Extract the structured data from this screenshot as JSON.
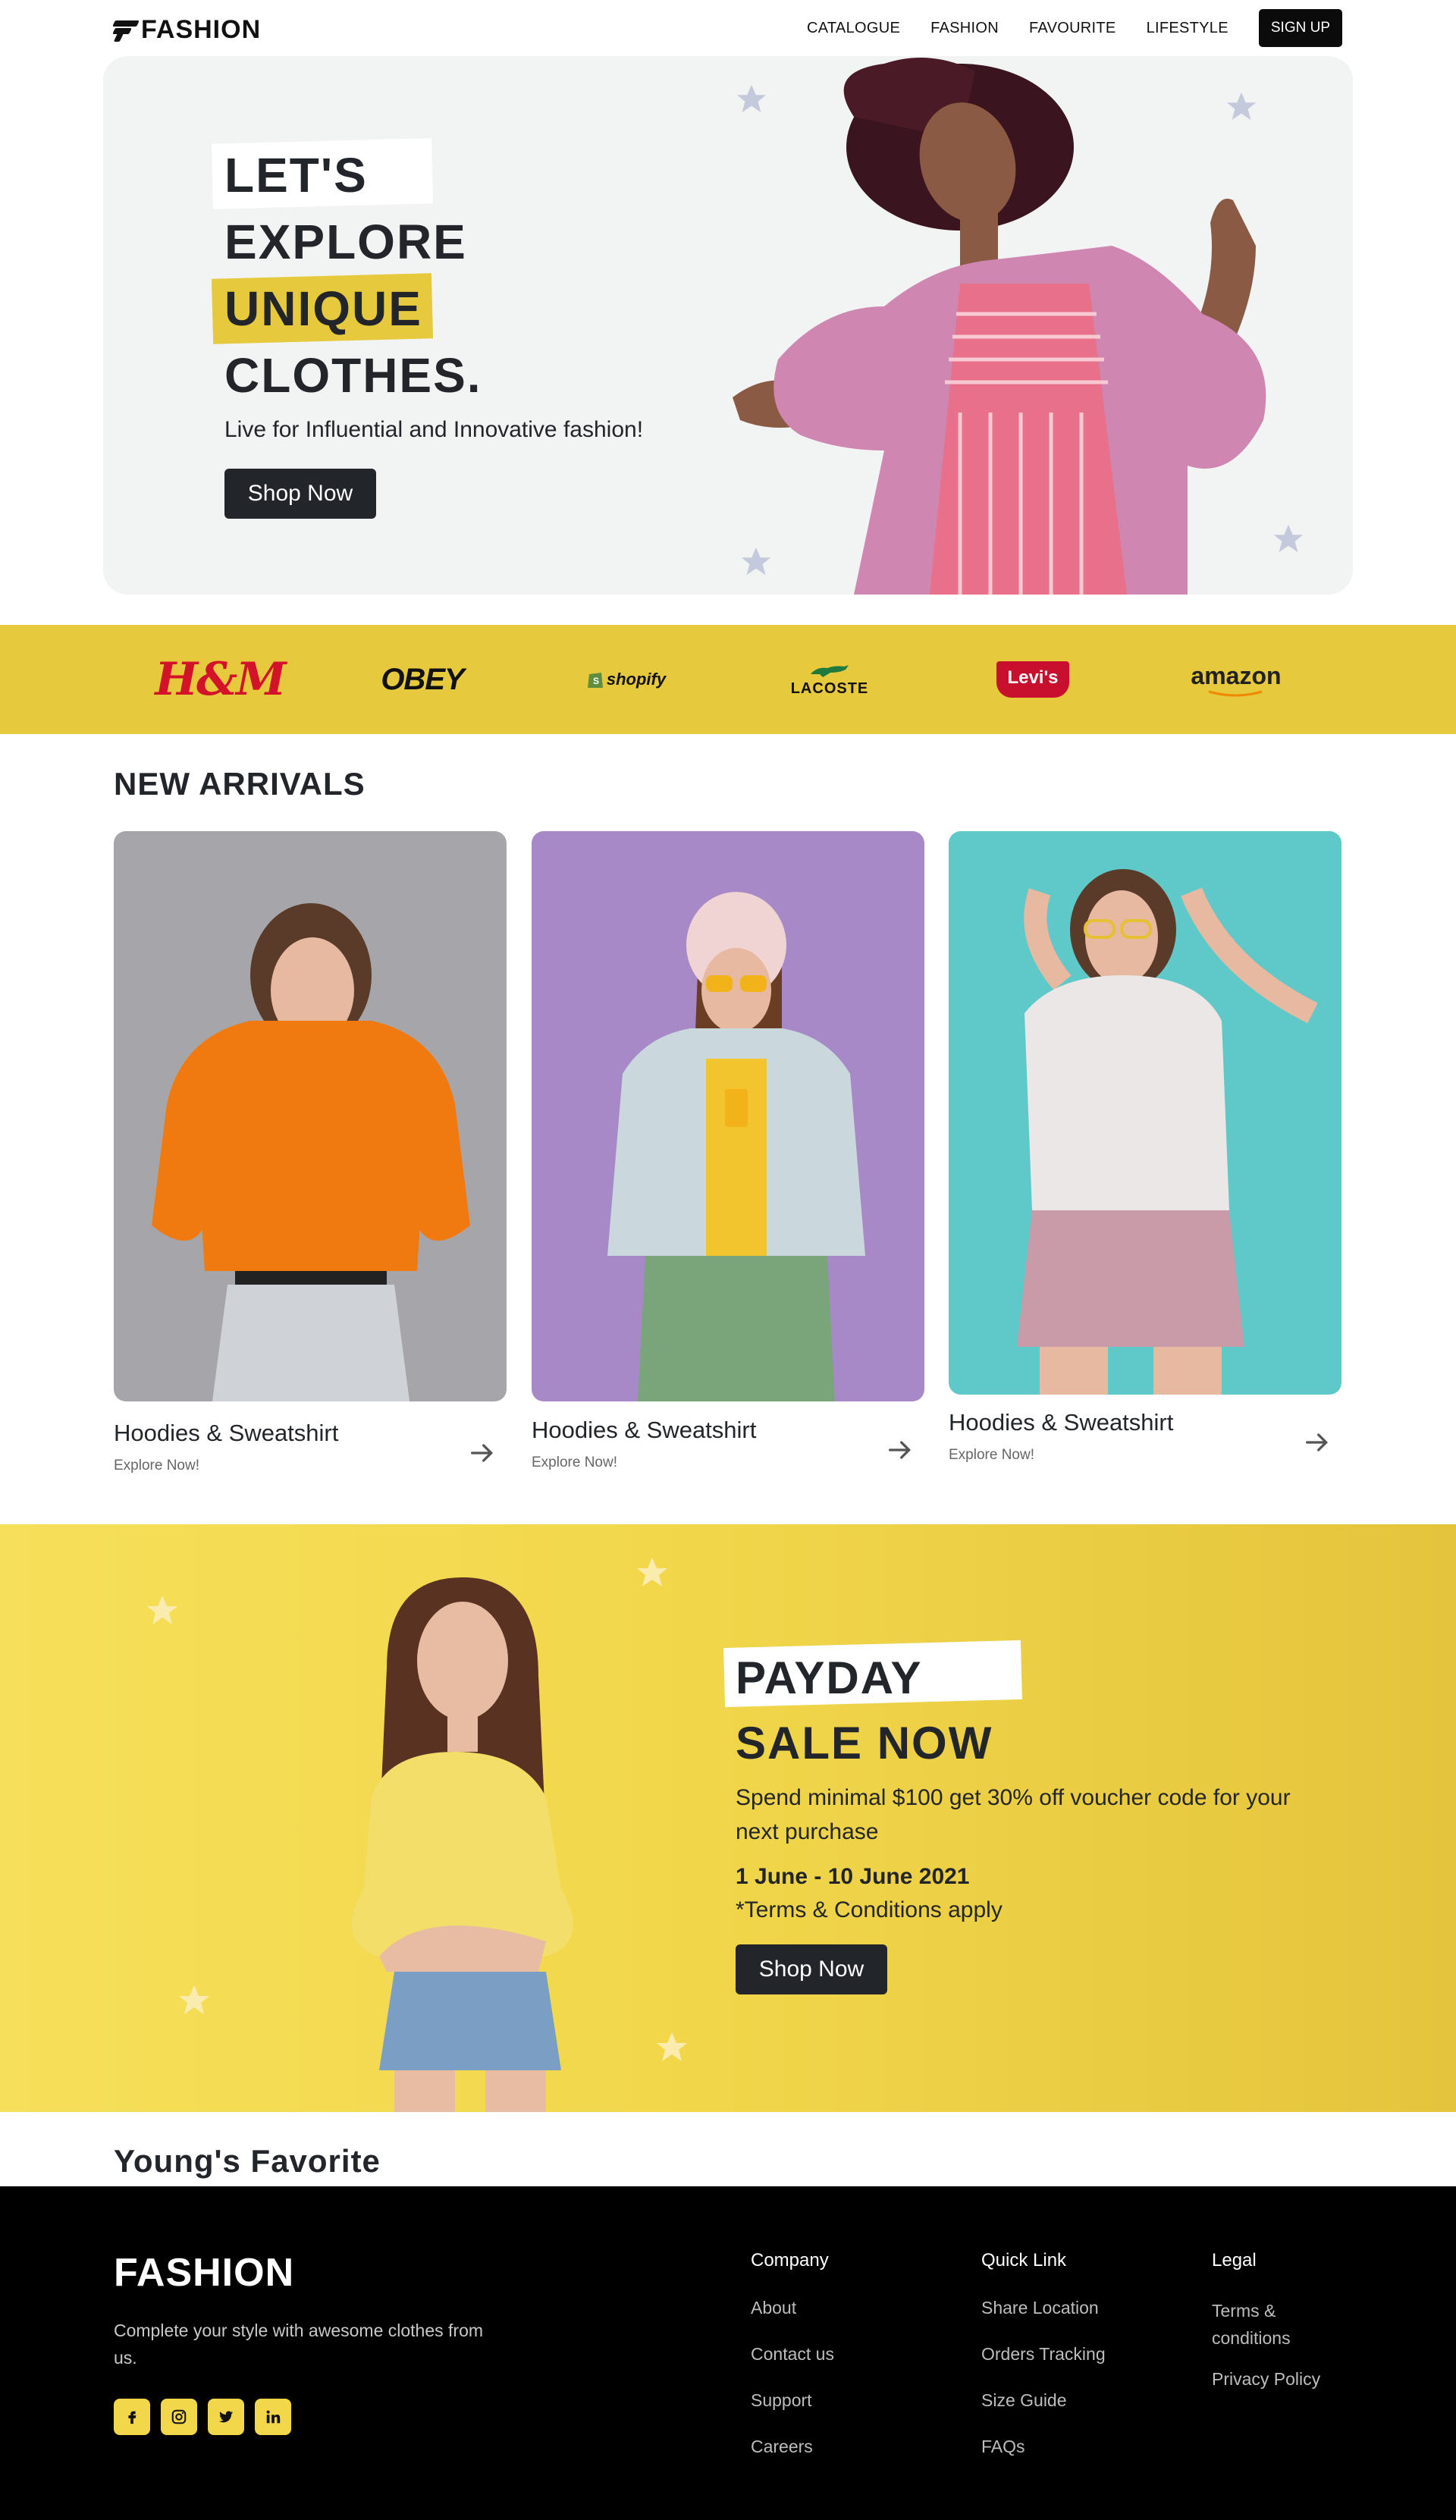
{
  "nav": {
    "logo": "FASHION",
    "links": [
      "CATALOGUE",
      "FASHION",
      "FAVOURITE",
      "LIFESTYLE"
    ],
    "signup": "SIGN UP"
  },
  "hero": {
    "line1": "LET'S",
    "line2": "EXPLORE",
    "line3": "UNIQUE",
    "line4": "CLOTHES.",
    "subtitle": "Live for Influential and Innovative fashion!",
    "button": "Shop Now",
    "accent": "#e6c93c"
  },
  "brands": [
    "H&M",
    "OBEY",
    "shopify",
    "LACOSTE",
    "Levi's",
    "amazon"
  ],
  "new_arrivals": {
    "title": "NEW ARRIVALS",
    "cards": [
      {
        "title": "Hoodies & Sweatshirt",
        "sub": "Explore Now!"
      },
      {
        "title": "Hoodies & Sweatshirt",
        "sub": "Explore Now!"
      },
      {
        "title": "Hoodies & Sweatshirt",
        "sub": "Explore Now!"
      }
    ]
  },
  "payday": {
    "line1": "PAYDAY",
    "line2": "SALE NOW",
    "text": "Spend minimal $100 get 30% off voucher code for your next purchase",
    "date": "1 June - 10 June 2021",
    "terms": "*Terms & Conditions apply",
    "button": "Shop Now"
  },
  "youngs": {
    "title": "Young's Favorite"
  },
  "footer": {
    "logo": "FASHION",
    "desc": "Complete your style with awesome clothes from us.",
    "socials": [
      "facebook-icon",
      "instagram-icon",
      "twitter-icon",
      "linkedin-icon"
    ],
    "columns": [
      {
        "title": "Company",
        "links": [
          "About",
          "Contact us",
          "Support",
          "Careers"
        ]
      },
      {
        "title": "Quick Link",
        "links": [
          "Share Location",
          "Orders Tracking",
          "Size Guide",
          "FAQs"
        ]
      },
      {
        "title": "Legal",
        "links": [
          "Terms & conditions",
          "Privacy Policy"
        ]
      }
    ]
  }
}
